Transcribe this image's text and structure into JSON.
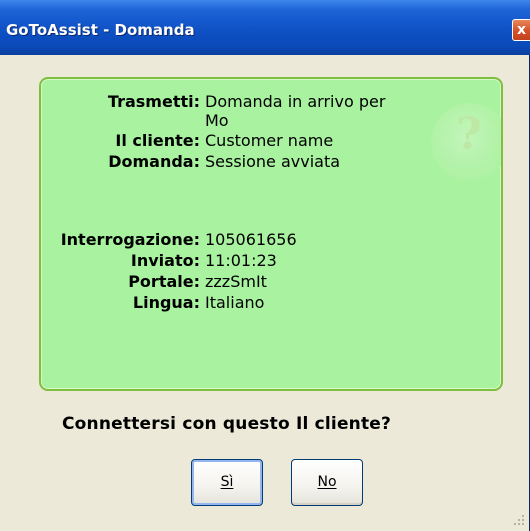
{
  "window": {
    "title": "GoToAssist - Domanda",
    "close_label": "x"
  },
  "details": {
    "trasmetti_label": "Trasmetti:",
    "trasmetti_value_line1": "Domanda in arrivo per",
    "trasmetti_value_line2": "Mo",
    "cliente_label": "Il cliente:",
    "cliente_value": "Customer name",
    "domanda_label": "Domanda:",
    "domanda_value": "Sessione avviata",
    "interrogazione_label": "Interrogazione:",
    "interrogazione_value": "105061656",
    "inviato_label": "Inviato:",
    "inviato_value": "11:01:23",
    "portale_label": "Portale:",
    "portale_value": "zzzSmIt",
    "lingua_label": "Lingua:",
    "lingua_value": "Italiano"
  },
  "prompt": {
    "question": "Connettersi con questo Il cliente?",
    "yes_label": "Sì",
    "no_label": "No"
  },
  "colors": {
    "panel_bg": "#a8f2a0",
    "panel_border": "#7ec03c",
    "titlebar": "#0f53c7",
    "window_bg": "#ece9d8"
  },
  "icons": {
    "close": "close-icon",
    "watermark": "question-bubble-icon"
  }
}
